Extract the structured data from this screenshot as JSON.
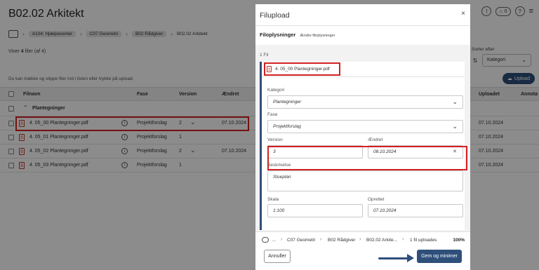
{
  "page": {
    "title": "B02.02 Arkitekt",
    "header_badge": "0",
    "breadcrumbs": [
      "A104: Hjælpecenter",
      "C07 Geometri",
      "B02 Rådgiver",
      "B02.02 Arkitekt"
    ],
    "viser_prefix": "Viser ",
    "viser_count": "4",
    "viser_suffix": " filer (af 4)",
    "drop_hint": "Du kan trække og slippe filer ind i listen eller trykke på upload.",
    "sort_label": "Sorter efter",
    "sort_value": "Kategori",
    "upload_label": "Upload",
    "columns": {
      "filename": "Filnavn",
      "phase": "Fase",
      "version": "Version",
      "changed": "Ændret",
      "uploaded": "Uploadet",
      "annotations": "Annota"
    },
    "group": "Plantegninger",
    "rows": [
      {
        "name": "4. 05_00 Plantegninger.pdf",
        "phase": "Projektforslag",
        "version": "2",
        "changed": "07.10.2024",
        "uploaded": "07.10.2024"
      },
      {
        "name": "4. 05_01 Plantegninger.pdf",
        "phase": "Projektforslag",
        "version": "1",
        "changed": "",
        "uploaded": "07.10.2024"
      },
      {
        "name": "4. 05_02 Plantegninger.pdf",
        "phase": "Projektforslag",
        "version": "2",
        "changed": "07.10.2024",
        "uploaded": "07.10.2024"
      },
      {
        "name": "4. 05_03 Plantegninger.pdf",
        "phase": "Projektforslag",
        "version": "1",
        "changed": "",
        "uploaded": "07.10.2024"
      }
    ]
  },
  "dialog": {
    "title": "Filupload",
    "close": "×",
    "subtitle": "Filoplysninger",
    "edit_link": "Ændre filoplysninger",
    "file_count": "1 Fil",
    "file_name": "4. 05_00 Plantegninger.pdf",
    "fields": {
      "kategori_label": "Kategori",
      "kategori_value": "Plantegninger",
      "fase_label": "Fase",
      "fase_value": "Projektforslag",
      "version_label": "Version",
      "version_value": "3",
      "aendret_label": "Ændret",
      "aendret_value": "08.10.2024",
      "beskrivelse_label": "Beskrivelse",
      "beskrivelse_value": "Stueplan",
      "skala_label": "Skala",
      "skala_value": "1:100",
      "oprettet_label": "Oprettet",
      "oprettet_value": "07.10.2024"
    },
    "progress": {
      "path": [
        "...",
        "C07 Geometri",
        "B02 Rådgiver",
        "B02.02 Arkite..."
      ],
      "status": "1 fil uploades",
      "percent": "100%"
    },
    "cancel_label": "Annuller",
    "save_label": "Gem og minimer"
  },
  "colors": {
    "accent": "#2e4f7a",
    "highlight": "#d32020",
    "pdf": "#c0392b"
  }
}
